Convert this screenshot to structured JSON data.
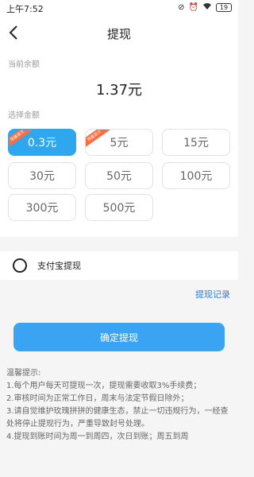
{
  "status": {
    "time": "上午7:52",
    "battery": "19"
  },
  "nav": {
    "title": "提现"
  },
  "balance": {
    "label": "当前余额",
    "value": "1.37元"
  },
  "amount_section": {
    "label": "选择金额",
    "options": [
      {
        "label": "0.3元",
        "tag": "限量首次"
      },
      {
        "label": "5元",
        "tag": "限量首次"
      },
      {
        "label": "15元"
      },
      {
        "label": "30元"
      },
      {
        "label": "50元"
      },
      {
        "label": "100元"
      },
      {
        "label": "300元"
      },
      {
        "label": "500元"
      }
    ]
  },
  "payment": {
    "alipay_label": "支付宝提现"
  },
  "history_link": "提现记录",
  "confirm_button": "确定提现",
  "tips": {
    "title": "温馨提示:",
    "items": [
      "1.每个用户每天可提现一次，提现需要收取3%手续费；",
      "2.审核时间为正常工作日，周末与法定节假日除外；",
      "3.请自觉维护玫瑰拼拼的健康生态，禁止一切违规行为，一经查处将停止提现行为，严重导致封号处理。",
      "4.提现到账时间为周一到周四，次日到账；周五到周"
    ]
  },
  "colors": {
    "accent": "#2ea7ef",
    "promo": "#ff6b3d",
    "link": "#2d7be0"
  }
}
